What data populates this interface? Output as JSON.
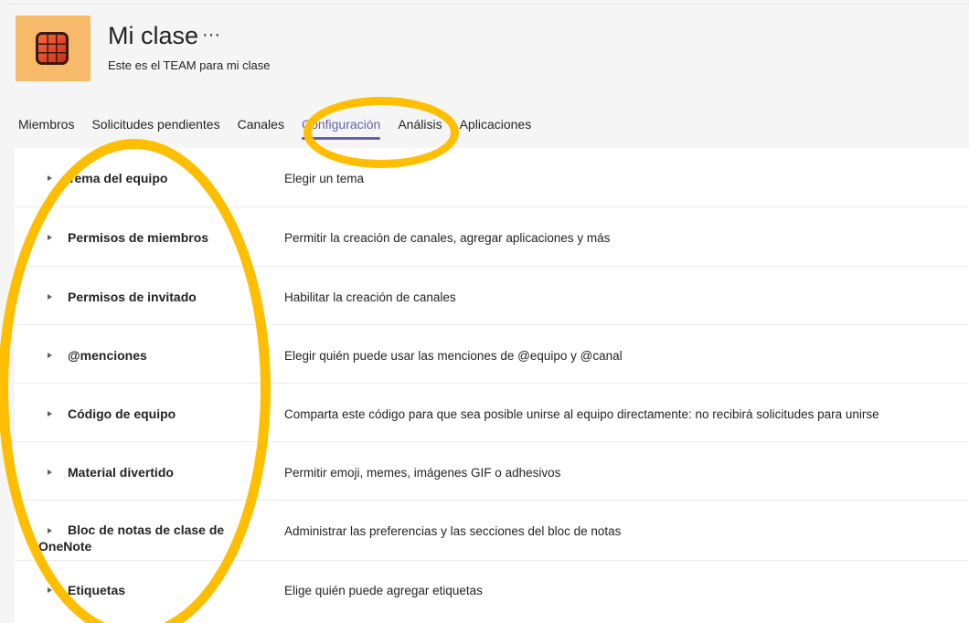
{
  "team": {
    "title": "Mi clase",
    "more": "···",
    "subtitle": "Este es el TEAM para mi clase"
  },
  "tabs": [
    {
      "label": "Miembros"
    },
    {
      "label": "Solicitudes pendientes"
    },
    {
      "label": "Canales"
    },
    {
      "label": "Configuración",
      "active": true
    },
    {
      "label": "Análisis"
    },
    {
      "label": "Aplicaciones"
    }
  ],
  "settings": [
    {
      "name": "Tema del equipo",
      "desc": "Elegir un tema"
    },
    {
      "name": "Permisos de miembros",
      "desc": "Permitir la creación de canales, agregar aplicaciones y más"
    },
    {
      "name": "Permisos de invitado",
      "desc": "Habilitar la creación de canales"
    },
    {
      "name": "@menciones",
      "desc": "Elegir quién puede usar las menciones de @equipo y @canal"
    },
    {
      "name": "Código de equipo",
      "desc": "Comparta este código para que sea posible unirse al equipo directamente: no recibirá solicitudes para unirse"
    },
    {
      "name": "Material divertido",
      "desc": "Permitir emoji, memes, imágenes GIF o adhesivos"
    },
    {
      "name": "Bloc de notas de clase de",
      "name_line2": "OneNote",
      "desc": "Administrar las preferencias y las secciones del bloc de notas"
    },
    {
      "name": "Etiquetas",
      "desc": "Elige quién puede agregar etiquetas"
    }
  ],
  "colors": {
    "accent": "#6264a7",
    "highlight": "#ffbf00",
    "logo_bg": "#f7b96a"
  },
  "icons": {
    "caret": "chevron-right-icon",
    "team_logo": "office-tile-icon"
  }
}
